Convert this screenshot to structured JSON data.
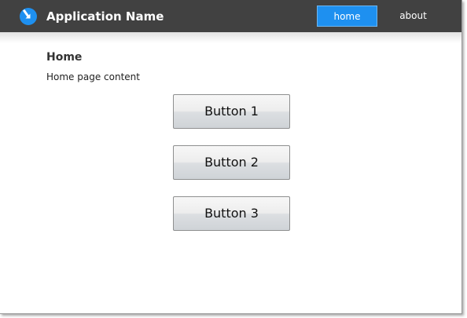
{
  "header": {
    "app_name": "Application Name",
    "logo_icon": "circular-arrow-logo-icon",
    "nav": {
      "home_label": "home",
      "about_label": "about",
      "active": "home"
    }
  },
  "main": {
    "title": "Home",
    "content": "Home page content",
    "buttons": [
      "Button 1",
      "Button 2",
      "Button 3"
    ]
  },
  "colors": {
    "header_bg": "#414141",
    "accent": "#1e90f0",
    "logo": "#1e90f0"
  }
}
